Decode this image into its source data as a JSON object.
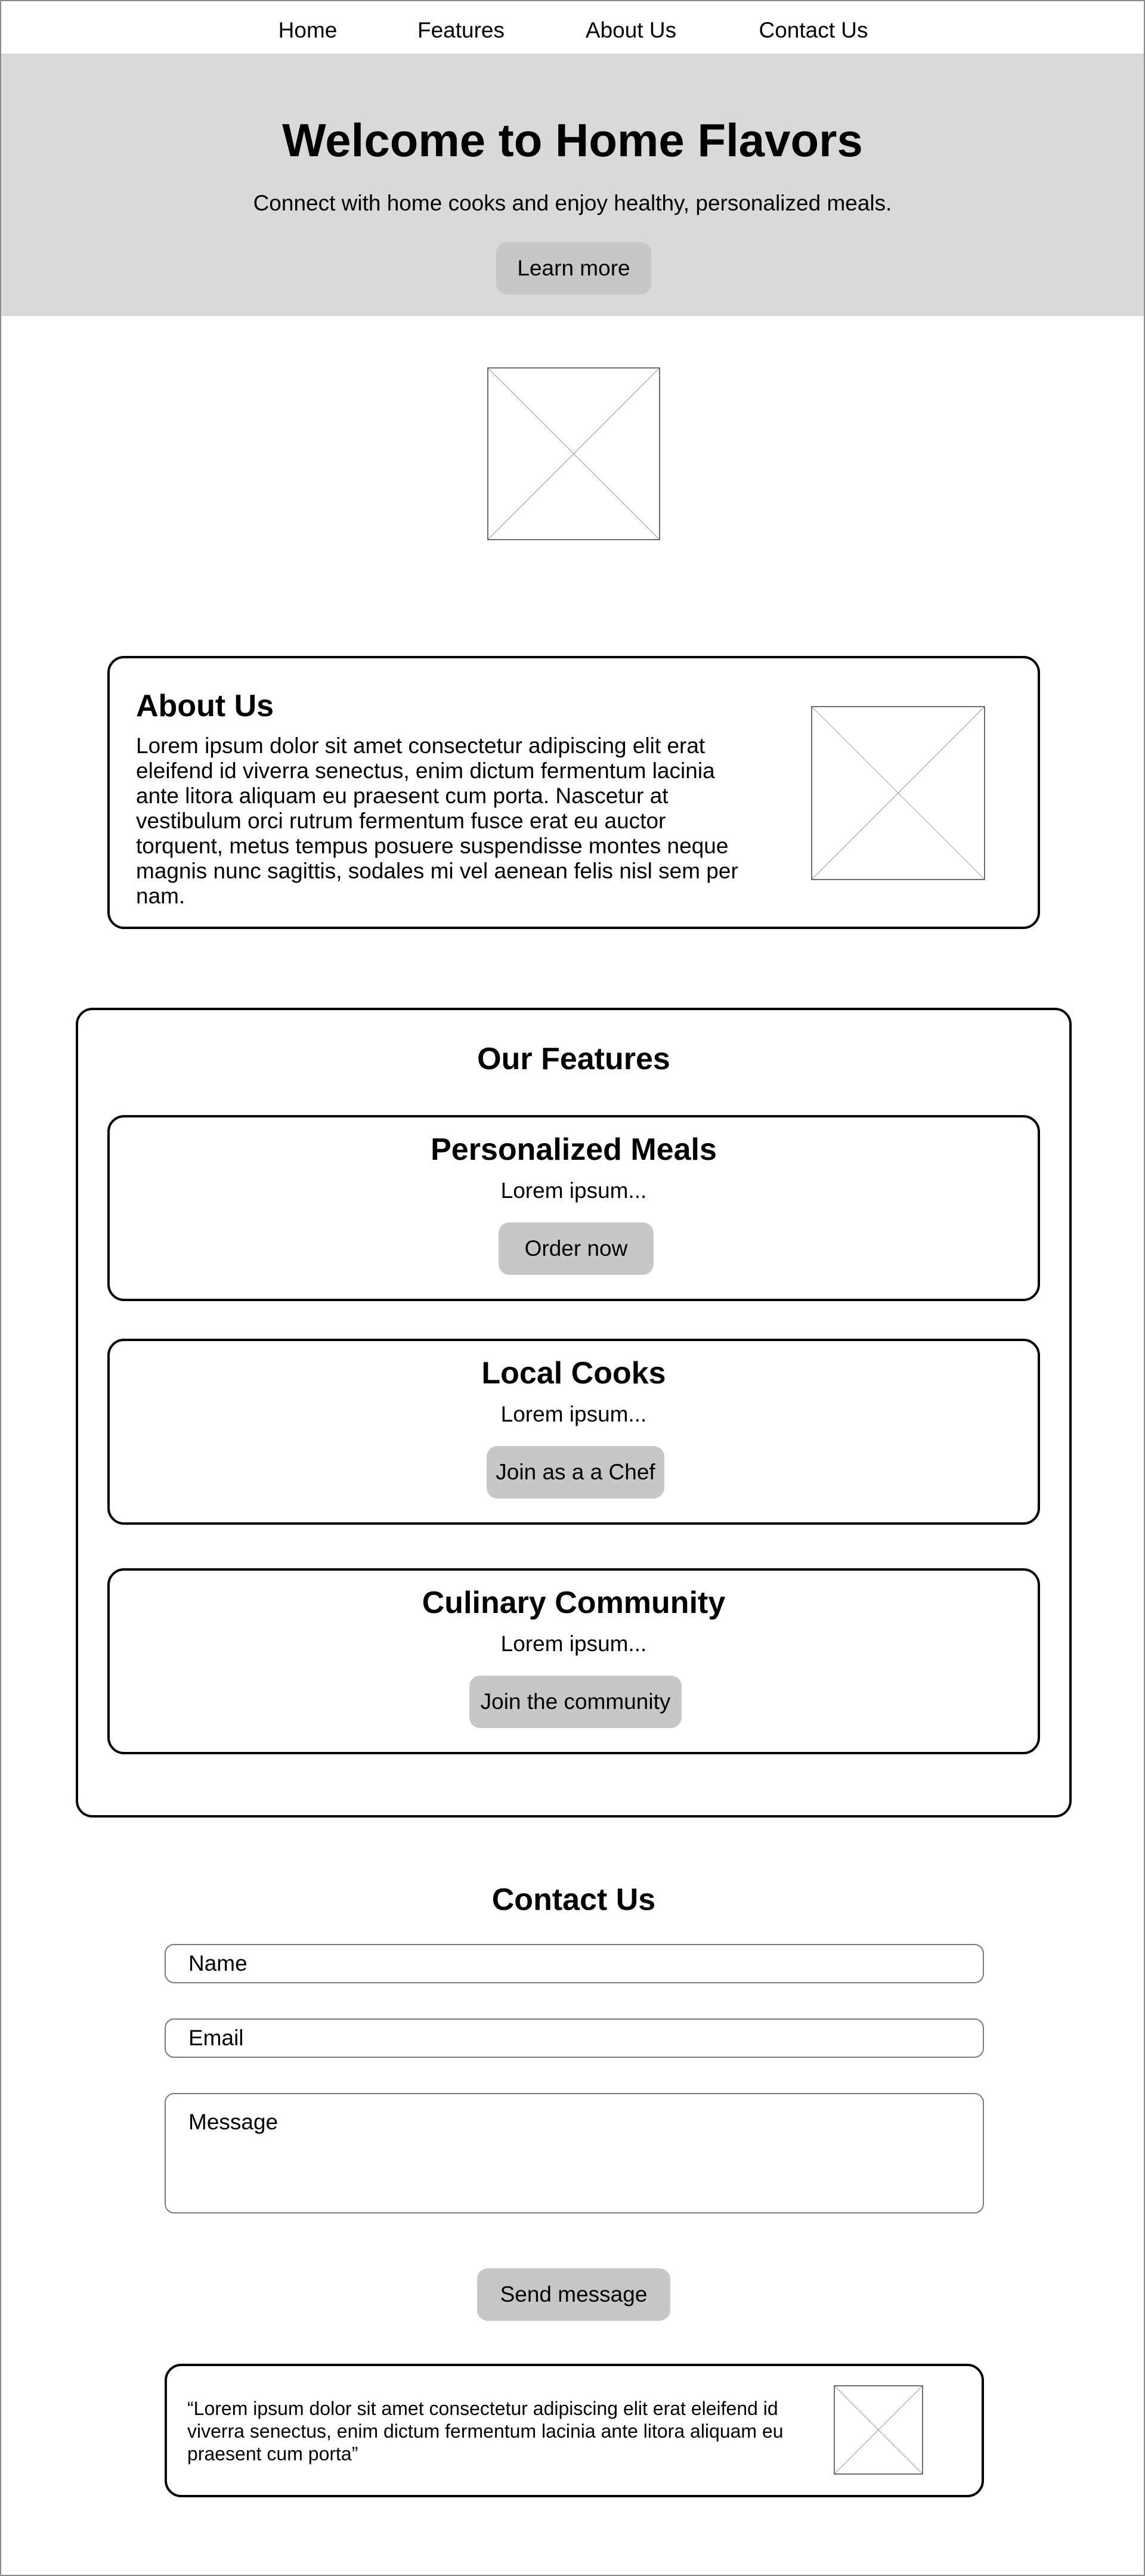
{
  "nav": {
    "items": [
      {
        "label": "Home"
      },
      {
        "label": "Features"
      },
      {
        "label": "About Us"
      },
      {
        "label": "Contact Us"
      }
    ]
  },
  "hero": {
    "title": "Welcome to Home Flavors",
    "subtitle": "Connect with home cooks and enjoy healthy, personalized meals.",
    "cta_label": "Learn more"
  },
  "about": {
    "title": "About Us",
    "text": "Lorem ipsum dolor sit amet consectetur adipiscing elit erat eleifend id viverra senectus, enim dictum fermentum lacinia ante litora aliquam eu praesent cum porta. Nascetur at vestibulum orci rutrum fermentum fusce erat eu auctor torquent, metus tempus posuere suspendisse montes neque magnis nunc sagittis, sodales mi vel aenean felis nisl sem per nam."
  },
  "features": {
    "title": "Our Features",
    "items": [
      {
        "title": "Personalized Meals",
        "text": "Lorem ipsum...",
        "button": "Order now"
      },
      {
        "title": "Local Cooks",
        "text": "Lorem ipsum...",
        "button": "Join as a a Chef"
      },
      {
        "title": "Culinary Community",
        "text": "Lorem ipsum...",
        "button": "Join the community"
      }
    ]
  },
  "contact": {
    "title": "Contact Us",
    "name_placeholder": "Name",
    "email_placeholder": "Email",
    "message_placeholder": "Message",
    "submit_label": "Send message"
  },
  "testimonial": {
    "quote": "“Lorem ipsum dolor sit amet consectetur adipiscing elit erat eleifend id viverra senectus, enim dictum fermentum lacinia ante litora aliquam eu praesent cum porta”"
  }
}
